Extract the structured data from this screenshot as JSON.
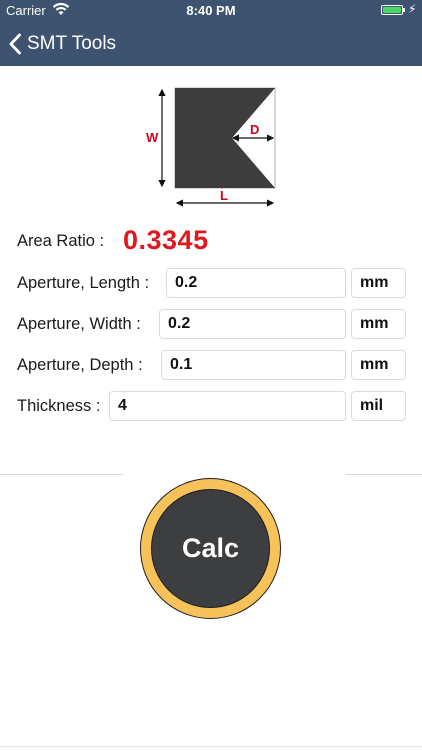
{
  "status_bar": {
    "carrier": "Carrier",
    "time": "8:40 PM",
    "battery_level": 1.0,
    "battery_color": "#4cd964"
  },
  "nav": {
    "back_label": "SMT Tools",
    "back_icon": "chevron-left-icon",
    "background": "#3e536f"
  },
  "diagram": {
    "label_w": "W",
    "label_d": "D",
    "label_l": "L",
    "label_color": "#d0021b",
    "fill_color": "#3d3d3d"
  },
  "area_ratio": {
    "label": "Area Ratio :",
    "value": "0.3345",
    "value_color": "#e0191f"
  },
  "fields": {
    "length": {
      "label": "Aperture, Length :",
      "value": "0.2",
      "unit": "mm"
    },
    "width": {
      "label": "Aperture, Width :",
      "value": "0.2",
      "unit": "mm"
    },
    "depth": {
      "label": "Aperture, Depth :",
      "value": "0.1",
      "unit": "mm"
    },
    "thickness": {
      "label": "Thickness :",
      "value": "4",
      "unit": "mil"
    }
  },
  "calc_button": {
    "label": "Calc",
    "ring_color": "#f7c25a",
    "core_color": "#3d3e40"
  }
}
